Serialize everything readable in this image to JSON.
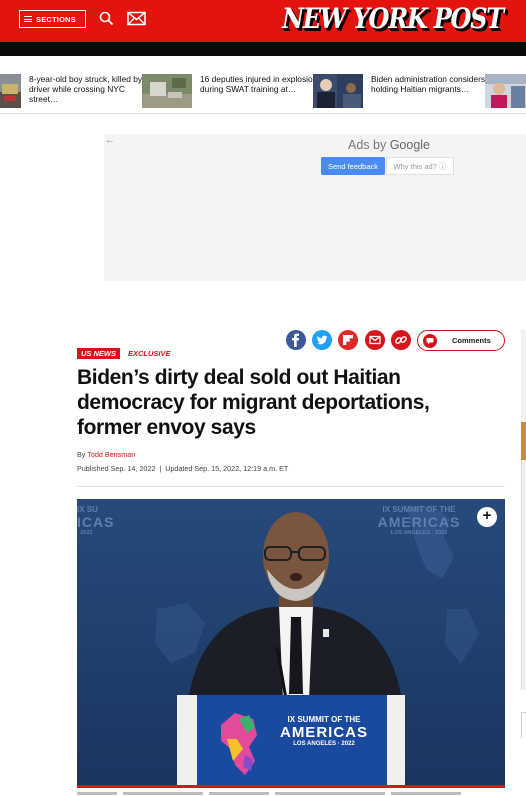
{
  "header": {
    "sections_label": "SECTIONS",
    "logo_text": "NEW YORK POST",
    "brand_red": "#e5130d"
  },
  "trending": [
    {
      "text": "8-year-old boy struck, killed by driver while crossing NYC street…"
    },
    {
      "text": "16 deputies injured in explosion during SWAT training at…"
    },
    {
      "text": "Biden administration considers holding Haitian migrants…"
    }
  ],
  "ad": {
    "back_arrow": "←",
    "ads_by": "Ads by",
    "google": "Google",
    "send_feedback": "Send feedback",
    "why_this_ad": "Why this ad? ⓘ"
  },
  "article": {
    "category": "US NEWS",
    "label": "EXCLUSIVE",
    "headline": "Biden’s dirty deal sold out Haitian democracy for migrant deportations, former envoy says",
    "by_prefix": "By",
    "author": "Todd Bensman",
    "published": "Published Sep. 14, 2022",
    "updated": "Updated Sep. 15, 2022, 12:19 a.m. ET",
    "separator": "|",
    "comments_label": "Comments"
  },
  "share": [
    {
      "icon": "facebook-icon",
      "glyph": "f",
      "color": "#3b5998"
    },
    {
      "icon": "twitter-icon",
      "glyph": "t",
      "color": "#1da1f2"
    },
    {
      "icon": "flipboard-icon",
      "glyph": "f",
      "color": "#e12828"
    },
    {
      "icon": "email-icon",
      "glyph": "✉",
      "color": "#d5141b"
    },
    {
      "icon": "link-icon",
      "glyph": "🔗",
      "color": "#d5141b"
    }
  ],
  "photo": {
    "plus_label": "+",
    "backdrop_top_line": "IX SUMMIT OF THE",
    "backdrop_mid_line": "AMERICAS",
    "backdrop_bottom_line": "LOS ANGELES · 2022",
    "left_backdrop_top": "IX SU",
    "left_backdrop_mid": "ICAS",
    "left_backdrop_bottom": "· 2022",
    "podium_top_line": "IX SUMMIT OF THE",
    "podium_mid_line": "AMERICAS",
    "podium_bottom_line": "LOS ANGELES · 2022"
  }
}
